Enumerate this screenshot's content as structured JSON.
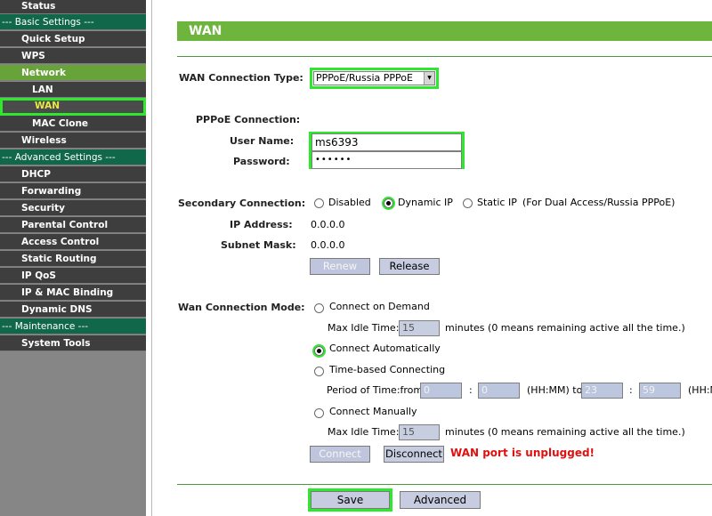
{
  "sidebar": {
    "items": [
      {
        "label": "Status"
      },
      {
        "label": "--- Basic Settings ---"
      },
      {
        "label": "Quick Setup"
      },
      {
        "label": "WPS"
      },
      {
        "label": "Network"
      },
      {
        "label": "LAN"
      },
      {
        "label": "WAN"
      },
      {
        "label": "MAC Clone"
      },
      {
        "label": "Wireless"
      },
      {
        "label": "--- Advanced Settings ---"
      },
      {
        "label": "DHCP"
      },
      {
        "label": "Forwarding"
      },
      {
        "label": "Security"
      },
      {
        "label": "Parental Control"
      },
      {
        "label": "Access Control"
      },
      {
        "label": "Static Routing"
      },
      {
        "label": "IP QoS"
      },
      {
        "label": "IP & MAC Binding"
      },
      {
        "label": "Dynamic DNS"
      },
      {
        "label": "--- Maintenance ---"
      },
      {
        "label": "System Tools"
      }
    ]
  },
  "page": {
    "title": "WAN"
  },
  "wan_type": {
    "label": "WAN Connection Type:",
    "selected": "PPPoE/Russia PPPoE"
  },
  "pppoe": {
    "section_label": "PPPoE Connection:",
    "username_label": "User Name:",
    "username_value": "ms6393",
    "password_label": "Password:",
    "password_value": "••••••"
  },
  "secondary": {
    "label": "Secondary Connection:",
    "options": [
      "Disabled",
      "Dynamic IP",
      "Static IP"
    ],
    "selected": "Dynamic IP",
    "note": "(For Dual Access/Russia PPPoE)",
    "ip_label": "IP Address:",
    "ip_value": "0.0.0.0",
    "mask_label": "Subnet Mask:",
    "mask_value": "0.0.0.0",
    "renew": "Renew",
    "release": "Release"
  },
  "mode": {
    "label": "Wan Connection Mode:",
    "on_demand": "Connect on Demand",
    "max_idle_label": "Max Idle Time:",
    "max_idle_value_1": "15",
    "idle_note": "minutes (0 means remaining active all the time.)",
    "automatic": "Connect Automatically",
    "time_based": "Time-based Connecting",
    "period_label": "Period of Time:from",
    "from_hh": "0",
    "from_mm": "0",
    "to_label": "(HH:MM) to",
    "to_hh": "23",
    "to_mm": "59",
    "hhmm_tail": "(HH:M",
    "colon": ":",
    "manual": "Connect Manually",
    "max_idle_value_2": "15",
    "selected": "Connect Automatically",
    "connect": "Connect",
    "disconnect": "Disconnect",
    "warning": "WAN port is unplugged!",
    "warning_color": "#e01010"
  },
  "footer": {
    "save": "Save",
    "advanced": "Advanced"
  },
  "colors": {
    "accent": "#6eb53e",
    "highlight": "#2ee82e",
    "sidebar_dark": "#3e3e3e",
    "section": "#10674a"
  }
}
